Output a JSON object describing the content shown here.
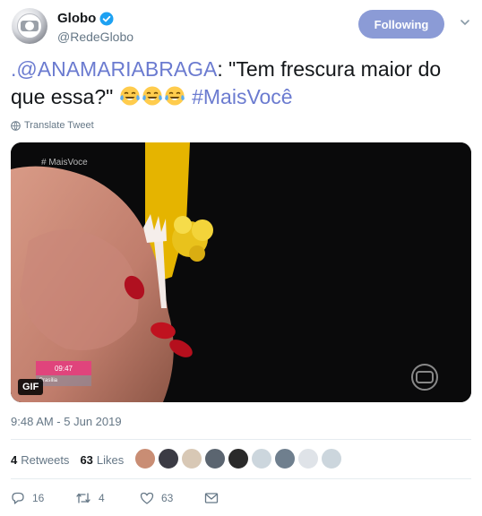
{
  "author": {
    "display_name": "Globo",
    "handle": "@RedeGlobo",
    "verified": true,
    "avatar_icon": "globo-logo-icon"
  },
  "follow_button": {
    "label": "Following"
  },
  "tweet": {
    "mention": ".@ANAMARIABRAGA",
    "text": ": \"Tem frescura maior do que essa?\" ",
    "emoji": "face-with-tears-of-joy-icon",
    "emoji_count": 3,
    "hashtag": "#MaisVocê"
  },
  "translate": {
    "label": "Translate Tweet"
  },
  "media": {
    "badge": "GIF",
    "overlay_tag": "# MaisVoce",
    "clock_time": "09:47",
    "clock_sub": "Brasília"
  },
  "timestamp": "9:48 AM - 5 Jun 2019",
  "stats": {
    "retweets_count": "4",
    "retweets_label": "Retweets",
    "likes_count": "63",
    "likes_label": "Likes"
  },
  "actions": {
    "replies": "16",
    "retweets": "4",
    "likes": "63"
  },
  "colors": {
    "accent": "#6b7bd0",
    "follow_bg": "#8b9bd6",
    "muted": "#657786"
  }
}
